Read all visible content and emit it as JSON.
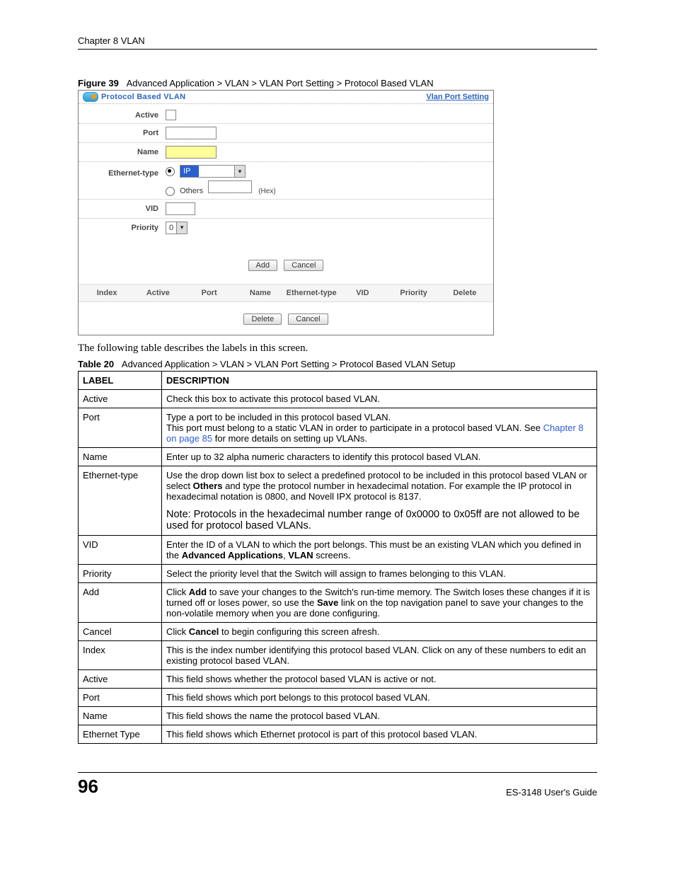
{
  "header": {
    "chapter": "Chapter 8 VLAN"
  },
  "figure": {
    "label": "Figure 39",
    "caption": "Advanced Application > VLAN > VLAN Port Setting > Protocol Based VLAN"
  },
  "screenshot": {
    "title": "Protocol Based VLAN",
    "link": "Vlan Port Setting",
    "rows": {
      "active": "Active",
      "port": "Port",
      "name": "Name",
      "ethtype": "Ethernet-type",
      "ip": "IP",
      "others": "Others",
      "hex": "(Hex)",
      "vid": "VID",
      "priority": "Priority",
      "priority_val": "0"
    },
    "buttons": {
      "add": "Add",
      "cancel": "Cancel",
      "delete": "Delete"
    },
    "grid": {
      "index": "Index",
      "active": "Active",
      "port": "Port",
      "name": "Name",
      "ethtype": "Ethernet-type",
      "vid": "VID",
      "priority": "Priority",
      "delete": "Delete"
    }
  },
  "body_text": "The following table describes the labels in this screen.",
  "table_caption": {
    "label": "Table 20",
    "caption": "Advanced Application > VLAN > VLAN Port Setting > Protocol Based VLAN Setup"
  },
  "table_head": {
    "label": "LABEL",
    "desc": "DESCRIPTION"
  },
  "rows": [
    {
      "label": "Active",
      "desc": "Check this box to activate this protocol based VLAN."
    },
    {
      "label": "Port",
      "desc": "Type a port to be included in this protocol based VLAN.\nThis port must belong to a static VLAN in order to participate in a protocol based VLAN. See |Chapter 8 on page 85| for more details on setting up VLANs."
    },
    {
      "label": "Name",
      "desc": "Enter up to 32 alpha numeric characters to identify this protocol based VLAN."
    },
    {
      "label": "Ethernet-type",
      "desc": "Use the drop down list box to select a predefined protocol to be included in this protocol based VLAN or select **Others** and type the protocol number in hexadecimal notation. For example the IP protocol in hexadecimal notation is 0800, and Novell IPX protocol is 8137.",
      "note": "Note: Protocols in the hexadecimal number range of 0x0000 to 0x05ff are not allowed to be used for protocol based VLANs."
    },
    {
      "label": "VID",
      "desc": "Enter the ID of a VLAN to which the port belongs. This must be an existing VLAN which you defined in the **Advanced Applications**, **VLAN** screens."
    },
    {
      "label": "Priority",
      "desc": "Select the priority level that the Switch will assign to frames belonging to this VLAN."
    },
    {
      "label": "Add",
      "desc": "Click **Add** to save your changes to the Switch's run-time memory. The Switch loses these changes if it is turned off or loses power, so use the **Save** link on the top navigation panel to save your changes to the non-volatile memory when you are done configuring."
    },
    {
      "label": "Cancel",
      "desc": "Click **Cancel** to begin configuring this screen afresh."
    },
    {
      "label": "Index",
      "desc": "This is the index number identifying this protocol based VLAN. Click on any of these numbers to edit an existing protocol based VLAN."
    },
    {
      "label": "Active",
      "desc": "This field shows whether the protocol based VLAN is active or not."
    },
    {
      "label": "Port",
      "desc": "This field shows which port belongs to this protocol based VLAN."
    },
    {
      "label": "Name",
      "desc": "This field shows the name the protocol based VLAN."
    },
    {
      "label": "Ethernet Type",
      "desc": "This field shows which Ethernet protocol is part of this protocol based VLAN."
    }
  ],
  "footer": {
    "page": "96",
    "guide": "ES-3148 User's Guide"
  }
}
